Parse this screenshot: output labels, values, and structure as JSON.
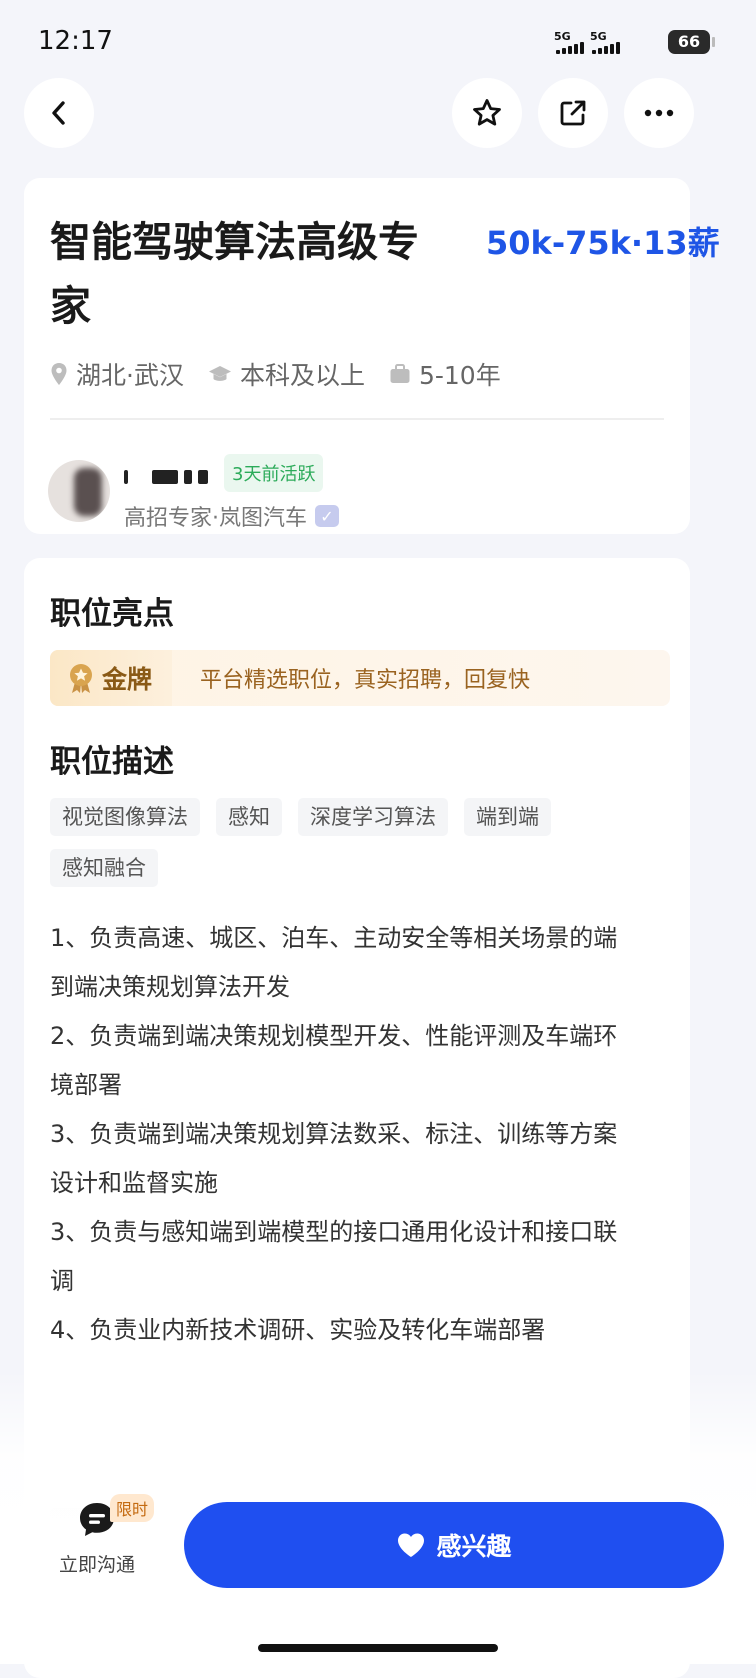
{
  "status_bar": {
    "time": "12:17",
    "signal1": "5G",
    "signal2": "5G",
    "battery": "66"
  },
  "job": {
    "title": "智能驾驶算法高级专家",
    "salary": "50k-75k·13薪",
    "location": "湖北·武汉",
    "education": "本科及以上",
    "experience": "5-10年"
  },
  "recruiter": {
    "active_status": "3天前活跃",
    "info": "高招专家·岚图汽车"
  },
  "highlights": {
    "heading": "职位亮点",
    "badge": "金牌",
    "text": "平台精选职位，真实招聘，回复快"
  },
  "description": {
    "heading": "职位描述",
    "tags": [
      "视觉图像算法",
      "感知",
      "深度学习算法",
      "端到端",
      "感知融合"
    ],
    "lines": [
      "1、负责高速、城区、泊车、主动安全等相关场景的端",
      "到端决策规划算法开发",
      "2、负责端到端决策规划模型开发、性能评测及车端环",
      "境部署",
      "3、负责端到端决策规划算法数采、标注、训练等方案",
      "设计和监督实施",
      "3、负责与感知端到端模型的接口通用化设计和接口联",
      "调",
      "4、负责业内新技术调研、实验及转化车端部署"
    ]
  },
  "bottom_bar": {
    "chat_label": "立即沟通",
    "limited_badge": "限时",
    "interest_label": "感兴趣"
  },
  "colors": {
    "accent": "#1f4ff0",
    "salary": "#1e55e6",
    "active_green": "#2cab5a",
    "gold": "#8a5a16"
  }
}
